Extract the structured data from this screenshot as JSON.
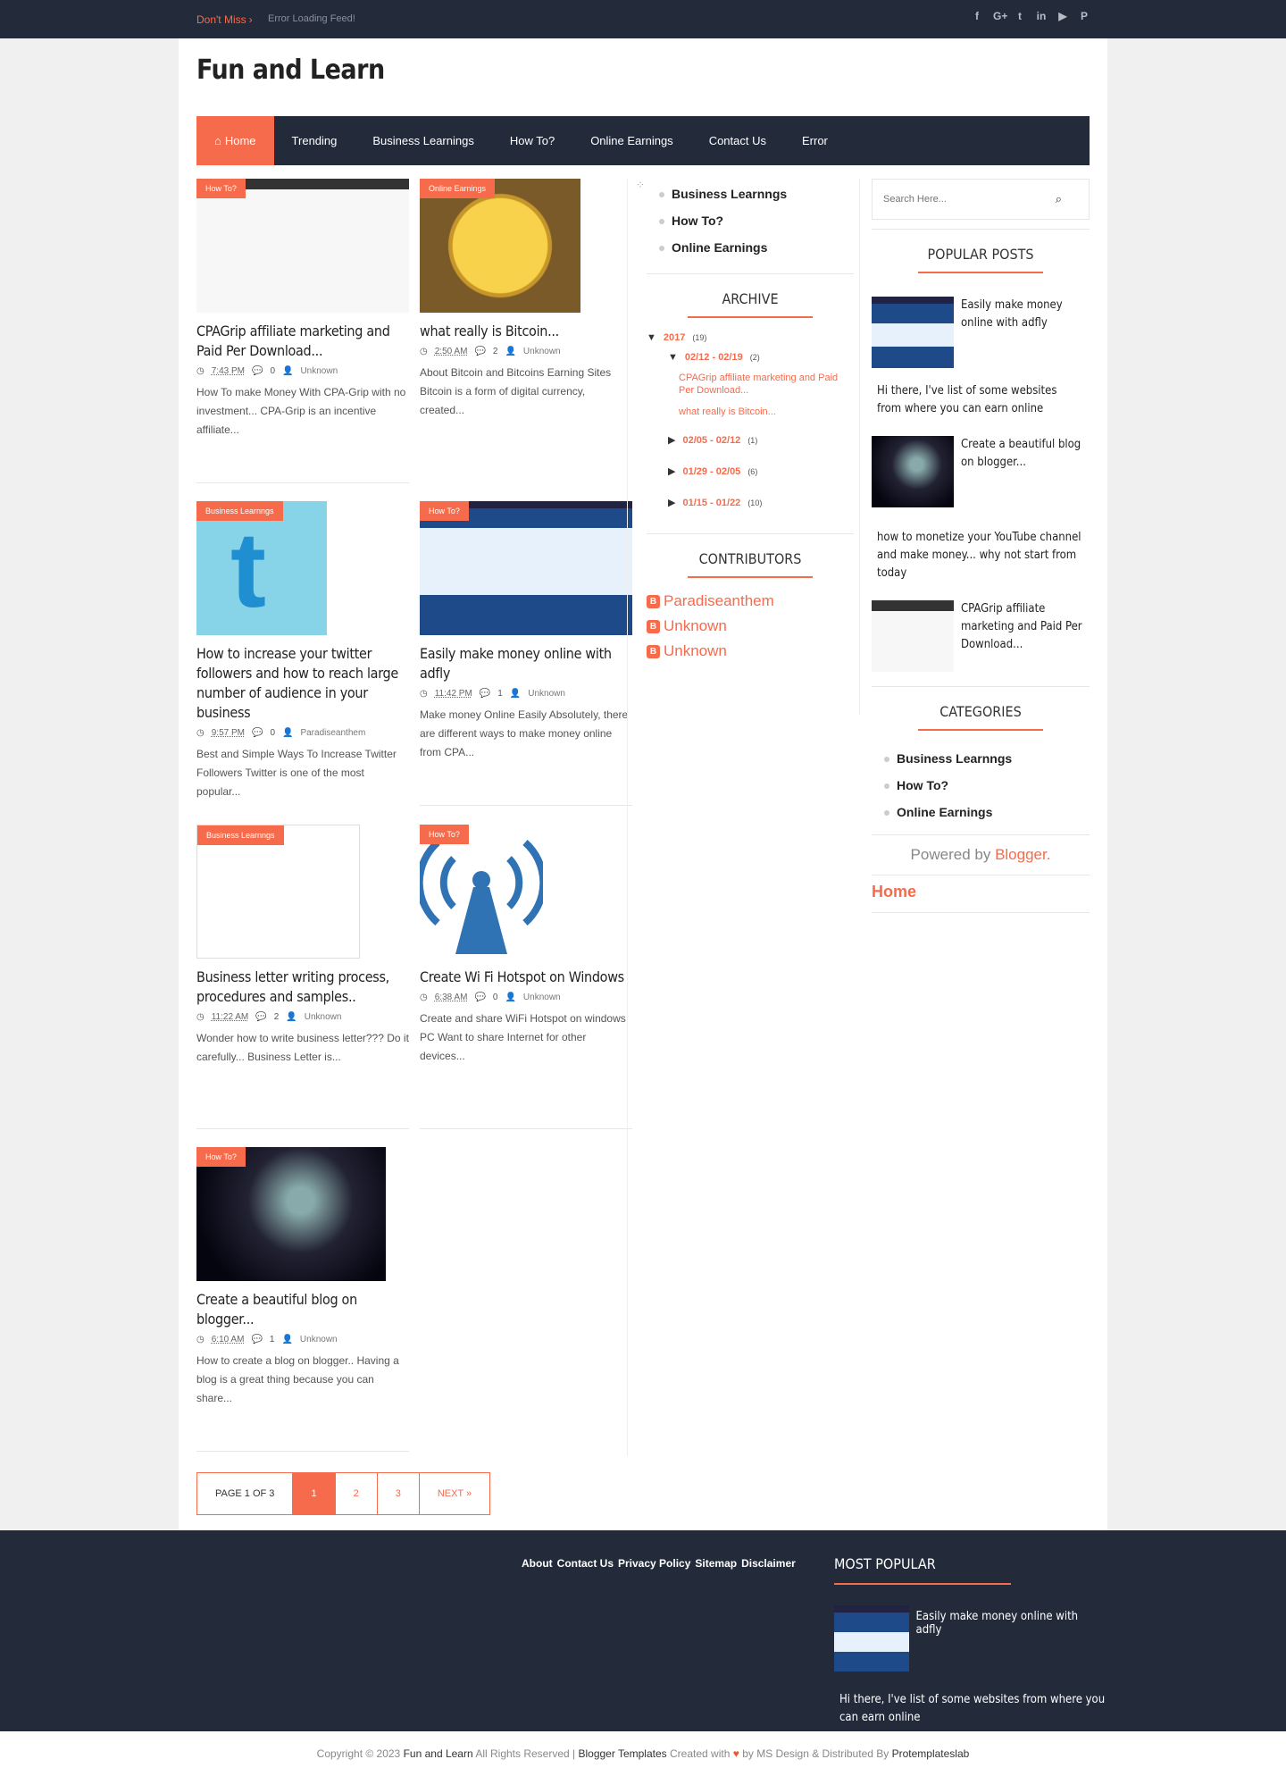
{
  "topbar": {
    "dont_miss": "Don't Miss",
    "feed_error": "Error Loading Feed!",
    "social_icons": [
      "facebook-icon",
      "google-plus-icon",
      "twitter-icon",
      "linkedin-icon",
      "youtube-icon",
      "pinterest-icon"
    ]
  },
  "site": {
    "title": "Fun and Learn"
  },
  "nav": [
    "Home",
    "Trending",
    "Business Learnings",
    "How To?",
    "Online Earnings",
    "Contact Us",
    "Error"
  ],
  "posts": [
    {
      "label": "How To?",
      "title": "CPAGrip affiliate marketing and Paid Per Download...",
      "time": "7:43 PM",
      "comments": "0",
      "author": "Unknown",
      "excerpt": "How To make Money With CPA-Grip with no investment... CPA-Grip is an incentive affiliate..."
    },
    {
      "label": "Online Earnings",
      "title": "what really is Bitcoin...",
      "time": "2:50 AM",
      "comments": "2",
      "author": "Unknown",
      "excerpt": "About Bitcoin  and Bitcoins Earning Sites Bitcoin is a form of digital currency, created..."
    },
    {
      "label": "Business Learnngs",
      "title": "How to increase your twitter followers and how to reach large number of audience in your business",
      "time": "9:57 PM",
      "comments": "0",
      "author": "Paradiseanthem",
      "excerpt": "Best  and Simple Ways To Increase Twitter Followers Twitter is one of the most popular..."
    },
    {
      "label": "How To?",
      "title": "Easily make money online with adfly",
      "time": "11:42 PM",
      "comments": "1",
      "author": "Unknown",
      "excerpt": "Make money Online Easily Absolutely, there are different ways to make money online from CPA..."
    },
    {
      "label": "Business Learnngs",
      "title": "Business letter writing process, procedures and samples..",
      "time": "11:22 AM",
      "comments": "2",
      "author": "Unknown",
      "excerpt": "Wonder how to write business letter??? Do it carefully... Business Letter is..."
    },
    {
      "label": "How To?",
      "title": "Create Wi Fi Hotspot on Windows",
      "time": "6:38 AM",
      "comments": "0",
      "author": "Unknown",
      "excerpt": "Create and share WiFi Hotspot on windows PC Want to share Internet for other devices..."
    },
    {
      "label": "How To?",
      "title": "Create a beautiful blog on blogger...",
      "time": "6:10 AM",
      "comments": "1",
      "author": "Unknown",
      "excerpt": "How to create a blog on blogger.. Having a blog is a great thing because you can share..."
    }
  ],
  "pager": {
    "info": "PAGE 1 OF 3",
    "p1": "1",
    "p2": "2",
    "p3": "3",
    "next": "NEXT »"
  },
  "mid_labels": [
    "Business Learnngs",
    "How To?",
    "Online Earnings"
  ],
  "archive": {
    "title": "ARCHIVE",
    "year": "2017",
    "year_count": "(19)",
    "w1": "02/12 - 02/19",
    "w1_count": "(2)",
    "w1_posts": [
      "CPAGrip affiliate marketing and Paid Per Download...",
      "what really is Bitcoin..."
    ],
    "w2": "02/05 - 02/12",
    "w2_count": "(1)",
    "w3": "01/29 - 02/05",
    "w3_count": "(6)",
    "w4": "01/15 - 01/22",
    "w4_count": "(10)"
  },
  "contributors": {
    "title": "CONTRIBUTORS",
    "names": [
      "Paradiseanthem",
      "Unknown",
      "Unknown"
    ]
  },
  "search": {
    "placeholder": "Search Here..."
  },
  "popular": {
    "title": "POPULAR POSTS",
    "items": [
      "Easily make money online with adfly",
      "Hi there, I've list of some websites from where you can earn online",
      "Create a beautiful blog on blogger...",
      "how to monetize your YouTube channel and make money... why not start from today",
      "CPAGrip affiliate marketing and Paid Per Download..."
    ]
  },
  "categories": {
    "title": "CATEGORIES",
    "items": [
      "Business Learnngs",
      "How To?",
      "Online Earnings"
    ]
  },
  "powered": {
    "text": "Powered by",
    "brand": "Blogger."
  },
  "home_link": "Home",
  "footer": {
    "links": [
      "About",
      "Contact Us",
      "Privacy Policy",
      "Sitemap",
      "Disclaimer"
    ],
    "most_popular": "MOST POPULAR",
    "mp_item": "Easily make money online with adfly",
    "mp_text": "Hi there, I've list of some websites from where you can earn online"
  },
  "copyright": {
    "prefix": "Copyright © 2023",
    "site": "Fun and Learn",
    "rights": "All Rights Reserved |",
    "templates": "Blogger Templates",
    "created": "Created with",
    "by": "by MS Design & Distributed By",
    "dist": "Protemplateslab"
  },
  "colors": {
    "accent": "#f66b4b",
    "dark": "#232b3a"
  }
}
